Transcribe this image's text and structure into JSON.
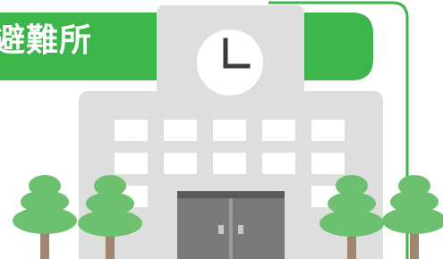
{
  "banner": {
    "label": "避難所"
  },
  "colors": {
    "accent_green": "#3cb54a",
    "building_light": "#dedede",
    "building_mid": "#cfcfcf",
    "window_white": "#ffffff",
    "door_dark": "#737373",
    "tree_green": "#6cc070",
    "trunk_brown": "#a1856f",
    "clock_hands": "#3a3a3a"
  },
  "icons": {
    "building": "school-building-icon",
    "clock": "clock-icon",
    "tree": "tree-icon",
    "door": "double-door-icon"
  }
}
